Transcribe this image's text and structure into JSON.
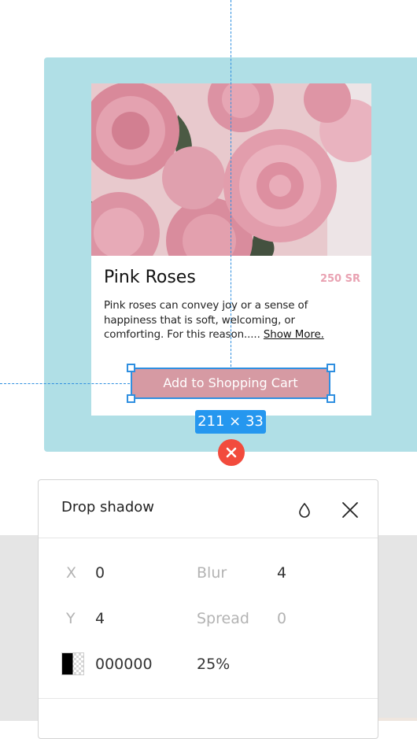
{
  "product_card": {
    "title": "Pink Roses",
    "price": "250 SR",
    "description_lines": [
      "Pink roses can convey joy or a sense of",
      "happiness that is soft, welcoming, or",
      "comforting. For this reason..... "
    ],
    "show_more_label": "Show More.",
    "cart_button_label": "Add to Shopping Cart"
  },
  "selection": {
    "dimensions_label": "211 × 33"
  },
  "effect_panel": {
    "title": "Drop shadow",
    "x_label": "X",
    "x_value": "0",
    "y_label": "Y",
    "y_value": "4",
    "blur_label": "Blur",
    "blur_value": "4",
    "spread_label": "Spread",
    "spread_value": "0",
    "color_hex": "000000",
    "opacity": "25%"
  },
  "colors": {
    "frame_bg": "#b0dfe6",
    "price": "#e9a2b2",
    "cart_button": "#d69aa3",
    "selection_blue": "#2f8fe0",
    "remove_red": "#f24b3d"
  },
  "icons": [
    "drop-icon",
    "close-icon",
    "remove-x-icon",
    "color-swatch-icon"
  ]
}
